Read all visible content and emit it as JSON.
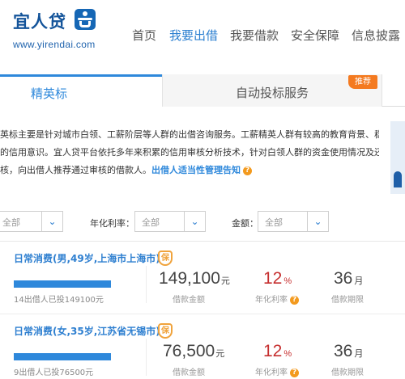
{
  "brand": {
    "name_cn": "宜人贷",
    "url": "www.yirendai.com"
  },
  "nav": [
    {
      "label": "首页",
      "active": false
    },
    {
      "label": "我要出借",
      "active": true
    },
    {
      "label": "我要借款",
      "active": false
    },
    {
      "label": "安全保障",
      "active": false
    },
    {
      "label": "信息披露",
      "active": false
    }
  ],
  "tabs": {
    "active": "精英标",
    "other": "自动投标服务",
    "badge": "推荐"
  },
  "description": {
    "line1": "英标主要是针对城市白领、工薪阶层等人群的出借咨询服务。工薪精英人群有较高的教育背景、稳定的经",
    "line2": "的信用意识。宜人贷平台依托多年来积累的信用审核分析技术，针对白领人群的资金使用情况及还款能力",
    "line3_prefix": "核，向出借人推荐通过审核的借款人。",
    "notice_link": "出借人适当性管理告知",
    "help_icon": "?"
  },
  "filters": {
    "select1_value": "全部",
    "rate_label": "年化利率：",
    "rate_value": "全部",
    "amount_label": "金额：",
    "amount_value": "全部"
  },
  "loans": [
    {
      "title": "日常消费(男,49岁,上海市上海市)",
      "guarantee_badge": "保",
      "progress_percent": 100,
      "progress_text": "14出借人已投149100元",
      "amount": "149,100",
      "amount_unit": "元",
      "amount_label": "借款金额",
      "rate": "12",
      "rate_unit": "%",
      "rate_label": "年化利率",
      "term": "36",
      "term_unit": "月",
      "term_label": "借款期限"
    },
    {
      "title": "日常消费(女,35岁,江苏省无锡市)",
      "guarantee_badge": "保",
      "progress_percent": 100,
      "progress_text": "9出借人已投76500元",
      "amount": "76,500",
      "amount_unit": "元",
      "amount_label": "借款金额",
      "rate": "12",
      "rate_unit": "%",
      "rate_label": "年化利率",
      "term": "36",
      "term_unit": "月",
      "term_label": "借款期限"
    }
  ],
  "colors": {
    "brand_blue": "#14549a",
    "accent_blue": "#2e88db",
    "rate_red": "#c62f2f",
    "badge_orange": "#f47a20"
  }
}
